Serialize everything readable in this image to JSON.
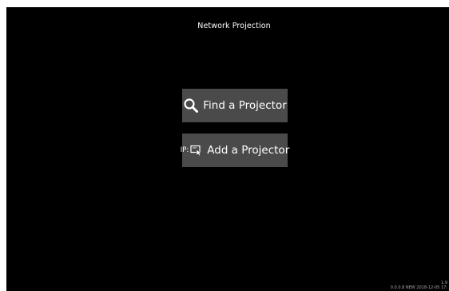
{
  "header": {
    "title": "Network Projection"
  },
  "buttons": {
    "find": {
      "label": "Find a Projector",
      "icon": "search-icon"
    },
    "add": {
      "prefix": "IP:",
      "label": "Add a Projector",
      "icon": "monitor-cursor-icon"
    }
  },
  "footer": {
    "version_line1": "1.9",
    "version_line2": "0.0.0.8 NEW 2018-12-05 17:"
  },
  "colors": {
    "background": "#000000",
    "button": "#4a4a4a",
    "text": "#ffffff"
  }
}
